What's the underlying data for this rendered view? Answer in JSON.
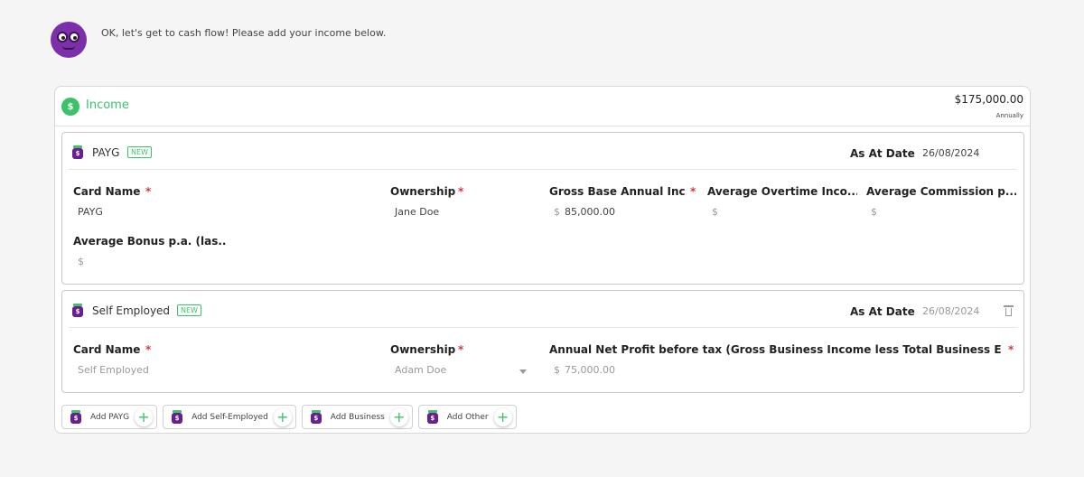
{
  "assistant": {
    "message": "OK, let's get to cash flow! Please add your income below."
  },
  "income": {
    "title": "Income",
    "total": "$175,000.00",
    "frequency": "Annually",
    "cards": [
      {
        "type": "PAYG",
        "badge": "NEW",
        "as_at_label": "As At Date",
        "as_at_value": "26/08/2024",
        "fields": {
          "card_name": {
            "label": "Card Name",
            "value": "PAYG"
          },
          "ownership": {
            "label": "Ownership",
            "value": "Jane Doe"
          },
          "gross_base": {
            "label": "Gross Base Annual Inc...",
            "currency": "$",
            "value": "85,000.00"
          },
          "avg_overtime": {
            "label": "Average Overtime Inco...",
            "currency": "$"
          },
          "avg_commission": {
            "label": "Average Commission p....",
            "currency": "$"
          },
          "avg_bonus": {
            "label": "Average Bonus p.a. (las...",
            "currency": "$"
          }
        }
      },
      {
        "type": "Self Employed",
        "badge": "NEW",
        "as_at_label": "As At Date",
        "as_at_value": "26/08/2024",
        "fields": {
          "card_name": {
            "label": "Card Name",
            "value": "Self Employed"
          },
          "ownership": {
            "label": "Ownership",
            "value": "Adam Doe"
          },
          "net_profit": {
            "label": "Annual Net Profit before tax (Gross Business Income less Total Business Expe...",
            "currency": "$",
            "value": "75,000.00"
          }
        }
      }
    ],
    "add_buttons": [
      "Add PAYG",
      "Add Self-Employed",
      "Add Business",
      "Add Other"
    ]
  },
  "colors": {
    "accent_green": "#3cc36a",
    "brand_purple": "#6a1f8f",
    "required_red": "#d9383f"
  },
  "icons": [
    "avatar-owl",
    "money-bag-icon",
    "trash-icon",
    "plus-icon"
  ],
  "required_mark": "*",
  "income_icon_glyph": "$"
}
